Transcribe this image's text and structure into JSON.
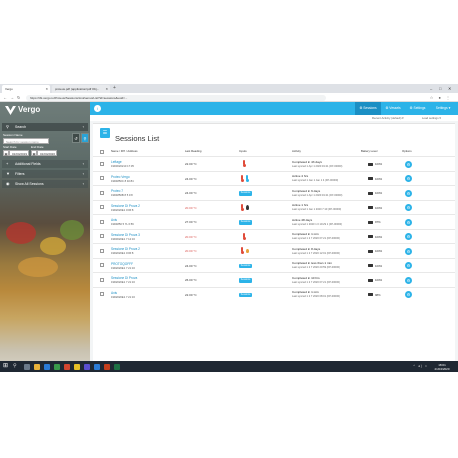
{
  "browser": {
    "tabs": [
      {
        "label": "Vergo"
      },
      {
        "label": "proteus.pdf (application/pdf Obj..."
      }
    ],
    "new_tab": "+",
    "url": "https://tbt.vergo.io/Proteus/Sessions/List/sensorList?id=sessions&uuid=..."
  },
  "sidebar": {
    "logo_text": "Vergo",
    "search_label": "Search",
    "session_name_label": "Session Name",
    "session_name_placeholder": "Search by session name",
    "start_date_label": "Start Date",
    "end_date_label": "End Date",
    "start_date_value": "01/04/2019",
    "end_date_value": "01/04/2020",
    "nav": [
      {
        "label": "Additional Fields"
      },
      {
        "label": "Filters"
      },
      {
        "label": "Show All Sessions"
      }
    ]
  },
  "topnav": {
    "menu_icon": "i",
    "tabs": [
      {
        "label": "Sessions",
        "icon": "⚙"
      },
      {
        "label": "Vessels",
        "icon": "⚙"
      },
      {
        "label": "Settings",
        "icon": "⚙"
      },
      {
        "label": "Settings ▾",
        "icon": ""
      }
    ],
    "sub_items": [
      "Recent Activity (default) ▾",
      "Load settings ▾"
    ]
  },
  "sessions": {
    "title": "Sessions List",
    "icon": "☰",
    "columns": [
      "Name / FPI / Address",
      "Last Reading",
      "Inputs",
      "Activity",
      "Battery Level",
      "Options"
    ],
    "rows": [
      {
        "name": "Leftage",
        "serial": "19D3020210 17:35",
        "reading": "22.00 °C",
        "red": false,
        "inputs": "therm-red",
        "activity": "Completed in 43 days",
        "last": "Last synced 1 Apr 1 2020 19:21 (FP-00000)",
        "battery": "100%"
      },
      {
        "name": "Proteo Vergo",
        "serial": "19D4850C 8 40:84",
        "reading": "24.00 °C",
        "red": false,
        "inputs": "therm-pair",
        "activity": "Active 4 hrs",
        "last": "Last synced 1 Jan 1 Jan 1 4 (FP-00000)",
        "battery": "100%"
      },
      {
        "name": "Proteo 7",
        "serial": "19D4850B 8 5 0:8",
        "reading": "24.00 °C",
        "red": false,
        "inputs": "pill",
        "activity": "Completed in 6 days",
        "last": "Last synced 1 Apr 1 2020 19:21 (FP-00000)",
        "battery": "100%"
      },
      {
        "name": "Sessione Di Prova 2",
        "serial": "19D2020E1 0:06:8",
        "reading": "20.00 °C",
        "red": true,
        "inputs": "therm-drop",
        "activity": "Active 1 hrs",
        "last": "Last synced 1 Jan 1 2020 7:10 (FP-00000)",
        "battery": "100%"
      },
      {
        "name": "Axis",
        "serial": "19D4850 5 7L 6:56",
        "reading": "27.00 °C",
        "red": false,
        "inputs": "pill",
        "activity": "Active 48 days",
        "last": "Last synced 1 2020 1 0 19:29 1 (FP-00000)",
        "battery": "97%"
      },
      {
        "name": "Sessione Di Prova 3",
        "serial": "19D3020E1 7 12:16",
        "reading": "20.00 °C",
        "red": true,
        "inputs": "therm-red",
        "activity": "Completed in 1 min",
        "last": "Last synced 1 2 7 2020 07:21 (FP-00000)",
        "battery": "100%"
      },
      {
        "name": "Sessione Di Prova 2",
        "serial": "19D2020E1 0:06:8",
        "reading": "20.00 °C",
        "red": true,
        "inputs": "therm-hand",
        "activity": "Completed in 8 days",
        "last": "Last synced 1 2 7 2020 12:01 (FP-00000)",
        "battery": "100%"
      },
      {
        "name": "PROTOQOFFF",
        "serial": "19D2020E1 7 21:16",
        "reading": "24.00 °C",
        "red": false,
        "inputs": "pill",
        "activity": "Completed in less than 1 min",
        "last": "Last synced 1 2 7 2020 20:59 (FP-00000)",
        "battery": "100%"
      },
      {
        "name": "Sessione Di Prova",
        "serial": "19D2020E1 7 21:16",
        "reading": "26.00 °C",
        "red": false,
        "inputs": "pill",
        "activity": "Completed in 10 hrs",
        "last": "Last synced 1 2 7 2020 07:21 (FP-00000)",
        "battery": "100%"
      },
      {
        "name": "Axis",
        "serial": "19D2020E1 7 21:16",
        "reading": "22.00 °C",
        "red": false,
        "inputs": "pill",
        "activity": "Completed in 1 min",
        "last": "Last synced 1 2 7 2020 08:01 (FP-00000)",
        "battery": "98%"
      }
    ],
    "pill_label": "Sessions",
    "option_glyph": "⚙"
  },
  "taskbar": {
    "start": "⊞",
    "search": "⚲",
    "time": "18:01",
    "date": "21/04/2020",
    "tray": "^ ◂) ⌂"
  },
  "colors": {
    "accent": "#2cb3e8",
    "active_tab": "#1b8fc4",
    "red_reading": "#d9534f",
    "taskbar": "#1f2833"
  }
}
